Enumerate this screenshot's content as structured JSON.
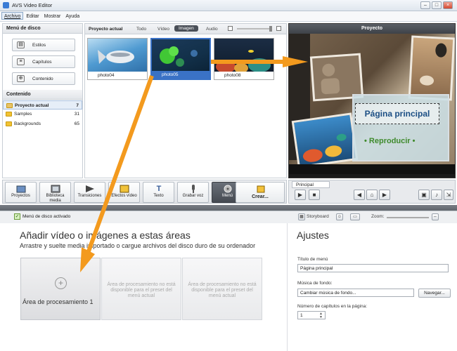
{
  "window": {
    "title": "AVS Video Editor"
  },
  "menubar": {
    "items": [
      "Archivo",
      "Editar",
      "Mostrar",
      "Ayuda"
    ]
  },
  "left_panel": {
    "title": "Menú de disco",
    "buttons": [
      "Estilos",
      "Capítulos",
      "Contenido"
    ],
    "content_title": "Contenido",
    "tree": [
      {
        "label": "Proyecto actual",
        "count": "7"
      },
      {
        "label": "Samples",
        "count": "31"
      },
      {
        "label": "Backgrounds",
        "count": "65"
      }
    ]
  },
  "media": {
    "project_label": "Proyecto actual",
    "tabs": [
      "Todo",
      "Vídeo",
      "Imagen",
      "Audio"
    ],
    "active_tab": "Imagen",
    "thumbs": [
      {
        "caption": "photo04"
      },
      {
        "caption": "photo05"
      },
      {
        "caption": "photo08"
      }
    ]
  },
  "preview": {
    "header": "Proyecto",
    "page_title": "Página principal",
    "play_label": "• Reproducir •"
  },
  "toolbar": {
    "buttons": [
      "Proyectos",
      "Biblioteca media",
      "Transiciones",
      "Efectos vídeo",
      "Texto",
      "Grabar voz",
      "Menú",
      "Crear..."
    ]
  },
  "playbar": {
    "tab": "Principal"
  },
  "statusbar": {
    "menu_activated": "Menú de disco activado",
    "storyboard": "Storyboard",
    "zoom": "Zoom:"
  },
  "main": {
    "title": "Añadir vídeo o imágenes a estas áreas",
    "subtitle": "Arrastre y suelte media importado o cargue archivos del disco duro de su ordenador",
    "area1_label": "Área de procesamiento 1",
    "area_disabled_label": "Área de procesamiento no está disponible para el preset del menú actual"
  },
  "settings": {
    "title": "Ajustes",
    "menu_title_label": "Título de menú",
    "menu_title_value": "Página principal",
    "music_label": "Música de fondo:",
    "music_value": "Cambiar música de fondo...",
    "browse_button": "Navegar...",
    "chapters_label": "Número de capítulos en la página:",
    "chapters_value": "1"
  },
  "colors": {
    "accent": "#f39a1e",
    "selection": "#3a72c6",
    "play_green": "#3e8a2b",
    "title_blue": "#1b4e84"
  }
}
